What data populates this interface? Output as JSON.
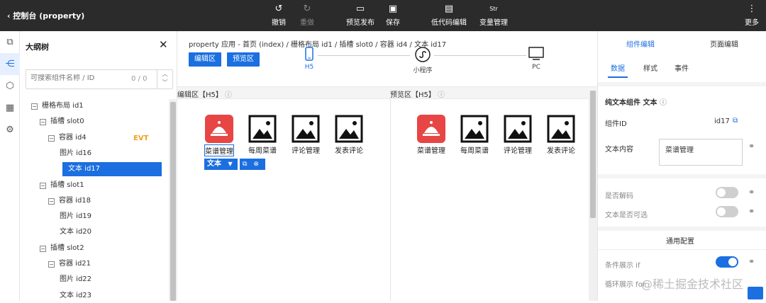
{
  "topbar": {
    "title": "控制台 (property)",
    "undo": "撤销",
    "redo": "重做",
    "preview_publish": "预览发布",
    "save": "保存",
    "lowcode": "低代码编辑",
    "vars": "变量管理",
    "more": "更多"
  },
  "outline": {
    "title": "大纲树",
    "search_placeholder": "可搜索组件名称 / ID",
    "search_count": "0 / 0",
    "evt_badge": "EVT",
    "tree": [
      {
        "label": "栅格布局 id1",
        "level": 0,
        "toggle": "−"
      },
      {
        "label": "插槽 slot0",
        "level": 1,
        "toggle": "−"
      },
      {
        "label": "容器 id4",
        "level": 2,
        "toggle": "−"
      },
      {
        "label": "图片 id16",
        "level": 3,
        "toggle": ""
      },
      {
        "label": "文本 id17",
        "level": 3,
        "toggle": "",
        "selected": true
      },
      {
        "label": "插槽 slot1",
        "level": 1,
        "toggle": "−"
      },
      {
        "label": "容器 id18",
        "level": 2,
        "toggle": "−"
      },
      {
        "label": "图片 id19",
        "level": 3,
        "toggle": ""
      },
      {
        "label": "文本 id20",
        "level": 3,
        "toggle": ""
      },
      {
        "label": "插槽 slot2",
        "level": 1,
        "toggle": "−"
      },
      {
        "label": "容器 id21",
        "level": 2,
        "toggle": "−"
      },
      {
        "label": "图片 id22",
        "level": 3,
        "toggle": ""
      },
      {
        "label": "文本 id23",
        "level": 3,
        "toggle": ""
      }
    ]
  },
  "center": {
    "breadcrumb": "property 应用 - 首页 (index)  /  栅格布局 id1  /  插槽 slot0  /  容器 id4  /  文本 id17",
    "edit_btn": "编辑区",
    "preview_btn": "预览区",
    "steps": [
      "H5",
      "小程序",
      "PC"
    ],
    "edit_header": "编辑区【H5】",
    "preview_header": "预览区【H5】",
    "components": [
      "菜谱管理",
      "每周菜谱",
      "评论管理",
      "发表评论"
    ],
    "selected_type": "文本"
  },
  "right": {
    "tab_component": "组件编辑",
    "tab_page": "页面编辑",
    "sub_data": "数据",
    "sub_style": "样式",
    "sub_event": "事件",
    "comp_title": "纯文本组件 文本",
    "comp_id_label": "组件ID",
    "comp_id_value": "id17",
    "text_content_label": "文本内容",
    "text_content_value": "菜谱管理",
    "decode_label": "是否解码",
    "selectable_label": "文本是否可选",
    "general_config": "通用配置",
    "cond_label": "条件展示 if",
    "loop_label": "循环展示 for"
  },
  "watermark": "@稀土掘金技术社区",
  "colors": {
    "accent": "#1b6fe0",
    "topbar": "#2b2b2b",
    "badge": "#f0a020",
    "red_icon": "#e84545"
  }
}
